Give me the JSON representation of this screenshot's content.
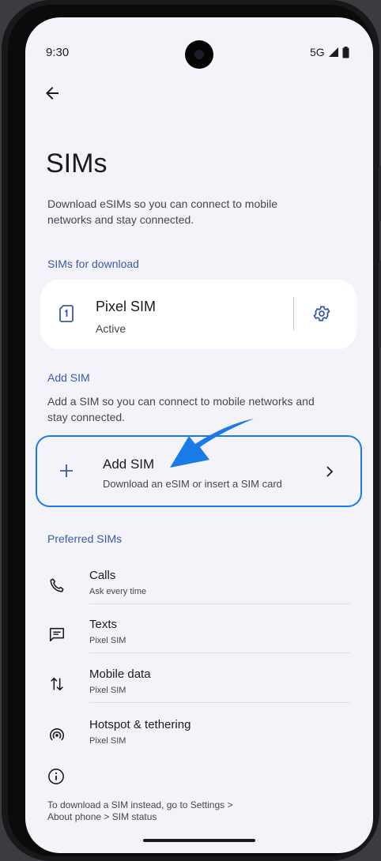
{
  "status_bar": {
    "time": "9:30",
    "network": "5G"
  },
  "header": {
    "title": "SIMs",
    "description": "Download eSIMs so you can connect to mobile networks and stay connected."
  },
  "sims_for_download": {
    "section_label": "SIMs for download",
    "sim": {
      "name": "Pixel SIM",
      "status": "Active"
    }
  },
  "add_sim": {
    "section_label": "Add SIM",
    "description": "Add a SIM so you can connect to mobile networks and stay connected.",
    "row": {
      "title": "Add SIM",
      "subtitle": "Download an eSIM or insert a SIM card"
    }
  },
  "preferred_sims": {
    "section_label": "Preferred SIMs",
    "items": [
      {
        "label": "Calls",
        "value": "Ask every time",
        "icon": "phone-icon"
      },
      {
        "label": "Texts",
        "value": "Pixel SIM",
        "icon": "message-icon"
      },
      {
        "label": "Mobile data",
        "value": "Pixel SIM",
        "icon": "data-arrows-icon"
      },
      {
        "label": "Hotspot & tethering",
        "value": "Pixel SIM",
        "icon": "hotspot-icon"
      }
    ]
  },
  "footer": {
    "text": "To download a SIM instead, go to Settings > About phone > SIM status"
  },
  "colors": {
    "accent": "#3a5ba9",
    "highlight": "#1a7ae6",
    "background": "#f4f3fa"
  }
}
